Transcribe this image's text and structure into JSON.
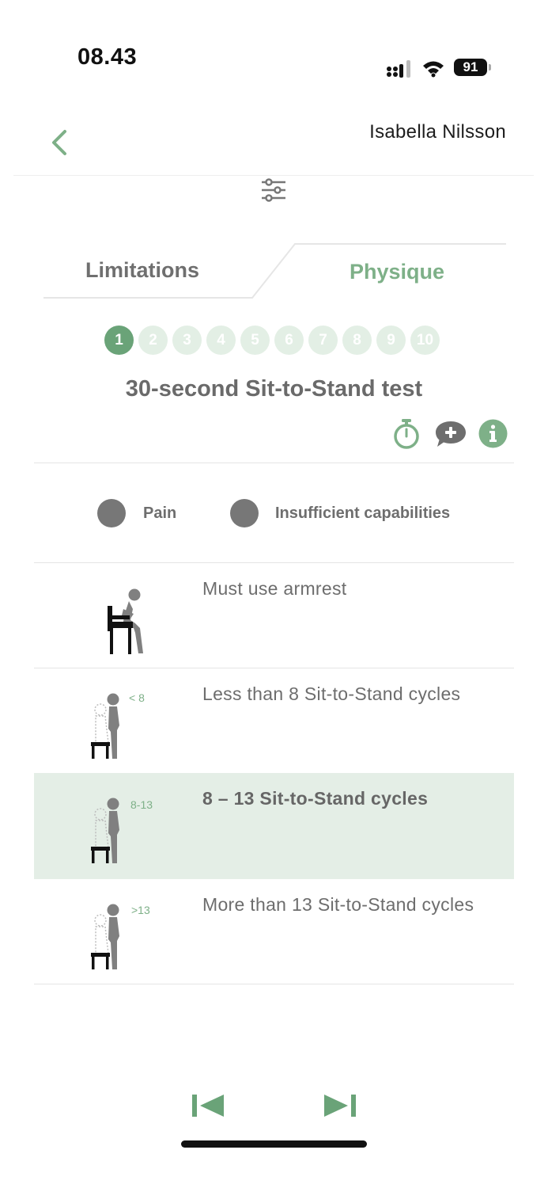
{
  "status_bar": {
    "time": "08.43",
    "battery": "91"
  },
  "header": {
    "user_name": "Isabella Nilsson",
    "back_icon": "chevron-left-icon",
    "filter_icon": "sliders-icon"
  },
  "tabs": [
    {
      "label": "Limitations",
      "active": false
    },
    {
      "label": "Physique",
      "active": true
    }
  ],
  "steps": [
    "1",
    "2",
    "3",
    "4",
    "5",
    "6",
    "7",
    "8",
    "9",
    "10"
  ],
  "active_step": "1",
  "test": {
    "title": "30-second Sit-to-Stand test"
  },
  "action_icons": [
    "stopwatch-icon",
    "add-comment-icon",
    "info-icon"
  ],
  "flags": [
    {
      "label": "Pain"
    },
    {
      "label": "Insufficient capabilities"
    }
  ],
  "options": [
    {
      "text": "Must use armrest",
      "badge": "",
      "selected": false
    },
    {
      "text": "Less than 8 Sit-to-Stand cycles",
      "badge": "< 8",
      "selected": false
    },
    {
      "text": "8 – 13 Sit-to-Stand cycles",
      "badge": "8-13",
      "selected": true
    },
    {
      "text": "More than 13 Sit-to-Stand cycles",
      "badge": ">13",
      "selected": false
    }
  ],
  "colors": {
    "accent": "#7eb088",
    "accent_dark": "#6aa378",
    "selected_bg": "#e4eee6",
    "text": "#6b6b6b"
  }
}
